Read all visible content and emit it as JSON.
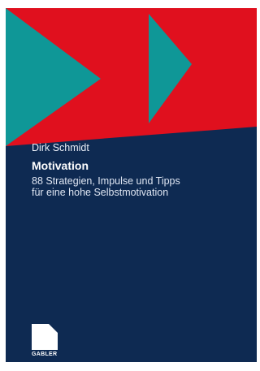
{
  "cover": {
    "author": "Dirk Schmidt",
    "title": "Motivation",
    "subtitle_line1": "88 Strategien, Impulse und Tipps",
    "subtitle_line2": "für eine hohe Selbstmotivation",
    "publisher": "GABLER",
    "logo_icon": "gabler-logo-icon",
    "colors": {
      "navy": "#0e2a52",
      "red": "#e0101e",
      "teal": "#0f9797",
      "text": "#ffffff"
    }
  }
}
